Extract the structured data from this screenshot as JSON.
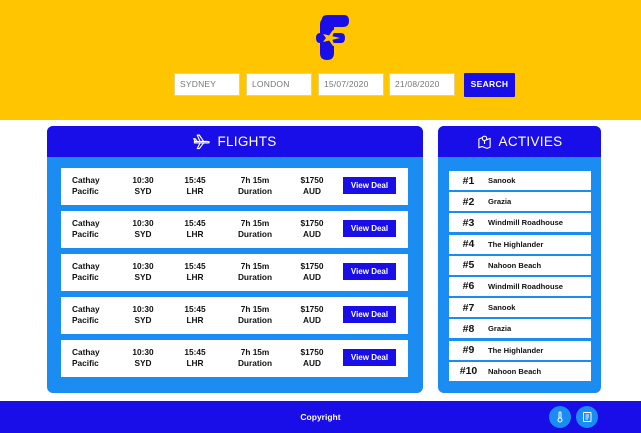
{
  "search": {
    "origin": "SYDNEY",
    "destination": "LONDON",
    "depart_date": "15/07/2020",
    "return_date": "21/08/2020",
    "button": "SEARCH"
  },
  "flights": {
    "title": "FLIGHTS",
    "rows": [
      {
        "airline1": "Cathay",
        "airline2": "Pacific",
        "dep_time": "10:30",
        "dep_code": "SYD",
        "arr_time": "15:45",
        "arr_code": "LHR",
        "duration": "7h 15m",
        "duration_label": "Duration",
        "price": "$1750",
        "currency": "AUD",
        "button": "View Deal"
      },
      {
        "airline1": "Cathay",
        "airline2": "Pacific",
        "dep_time": "10:30",
        "dep_code": "SYD",
        "arr_time": "15:45",
        "arr_code": "LHR",
        "duration": "7h 15m",
        "duration_label": "Duration",
        "price": "$1750",
        "currency": "AUD",
        "button": "View Deal"
      },
      {
        "airline1": "Cathay",
        "airline2": "Pacific",
        "dep_time": "10:30",
        "dep_code": "SYD",
        "arr_time": "15:45",
        "arr_code": "LHR",
        "duration": "7h 15m",
        "duration_label": "Duration",
        "price": "$1750",
        "currency": "AUD",
        "button": "View Deal"
      },
      {
        "airline1": "Cathay",
        "airline2": "Pacific",
        "dep_time": "10:30",
        "dep_code": "SYD",
        "arr_time": "15:45",
        "arr_code": "LHR",
        "duration": "7h 15m",
        "duration_label": "Duration",
        "price": "$1750",
        "currency": "AUD",
        "button": "View Deal"
      },
      {
        "airline1": "Cathay",
        "airline2": "Pacific",
        "dep_time": "10:30",
        "dep_code": "SYD",
        "arr_time": "15:45",
        "arr_code": "LHR",
        "duration": "7h 15m",
        "duration_label": "Duration",
        "price": "$1750",
        "currency": "AUD",
        "button": "View Deal"
      }
    ]
  },
  "activities": {
    "title": "ACTIVIES",
    "items": [
      {
        "num": "#1",
        "name": "Sanook"
      },
      {
        "num": "#2",
        "name": "Grazia"
      },
      {
        "num": "#3",
        "name": "Windmill Roadhouse"
      },
      {
        "num": "#4",
        "name": "The Highlander"
      },
      {
        "num": "#5",
        "name": "Nahoon Beach"
      },
      {
        "num": "#6",
        "name": "Windmill Roadhouse"
      },
      {
        "num": "#7",
        "name": "Sanook"
      },
      {
        "num": "#8",
        "name": "Grazia"
      },
      {
        "num": "#9",
        "name": "The Highlander"
      },
      {
        "num": "#10",
        "name": "Nahoon Beach"
      }
    ]
  },
  "footer": {
    "copyright": "Copyright",
    "icons": [
      "thermometer-icon",
      "notebook-icon"
    ]
  },
  "colors": {
    "header_bg": "#ffc600",
    "primary": "#1a0ee8",
    "panel_bg": "#1a8cf2"
  },
  "icons": {
    "logo": "f-plane-logo",
    "flights_header": "airplane-icon",
    "activities_header": "map-pin-icon"
  }
}
